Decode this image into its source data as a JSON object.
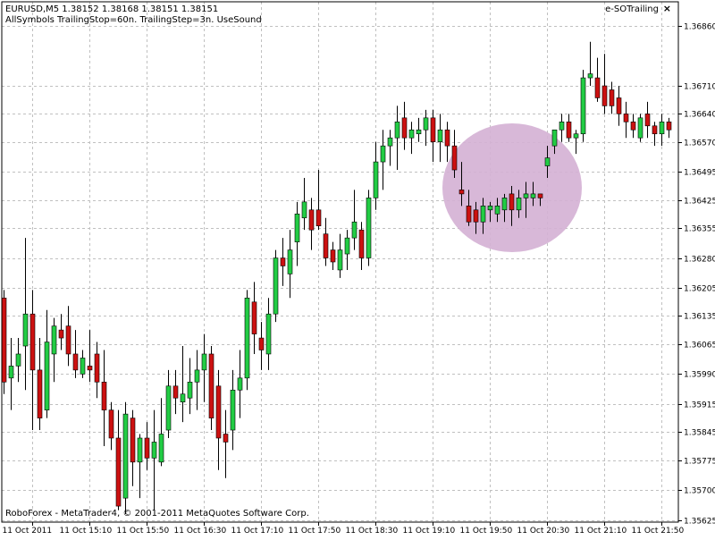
{
  "header": {
    "symbol_line": "EURUSD,M5  1.38152 1.38168 1.38151 1.38151",
    "settings_line": "AllSymbols  TrailingStop=60n.  TrailingStep=3n.  UseSound"
  },
  "expert": {
    "name": "e-SOTrailing",
    "close_glyph": "×"
  },
  "footer": {
    "copyright": "RoboForex - MetaTrader4, © 2001-2011 MetaQuotes Software Corp."
  },
  "colors": {
    "up": "#22cc44",
    "down": "#cc1111",
    "grid": "#c0c0c0",
    "highlight": "#d4b0d4"
  },
  "chart_data": {
    "type": "candlestick",
    "title": "",
    "ylim": [
      1.3562,
      1.3692
    ],
    "y_ticks": [
      "1.36860",
      "1.36710",
      "1.36640",
      "1.36570",
      "1.36495",
      "1.36425",
      "1.36355",
      "1.36280",
      "1.36205",
      "1.36135",
      "1.36065",
      "1.35990",
      "1.35915",
      "1.35845",
      "1.35775",
      "1.35700",
      "1.35625"
    ],
    "x_ticks": [
      "11 Oct 2011",
      "11 Oct 15:10",
      "11 Oct 15:50",
      "11 Oct 16:30",
      "11 Oct 17:10",
      "11 Oct 17:50",
      "11 Oct 18:30",
      "11 Oct 19:10",
      "11 Oct 19:50",
      "11 Oct 20:30",
      "11 Oct 21:10",
      "11 Oct 21:50"
    ],
    "candles": [
      [
        1.3618,
        1.362,
        1.3594,
        1.3597
      ],
      [
        1.3598,
        1.3608,
        1.359,
        1.3601
      ],
      [
        1.3601,
        1.3608,
        1.3597,
        1.3604
      ],
      [
        1.3606,
        1.3633,
        1.3595,
        1.3614
      ],
      [
        1.3614,
        1.362,
        1.3585,
        1.36
      ],
      [
        1.36,
        1.3608,
        1.3585,
        1.3588
      ],
      [
        1.359,
        1.3615,
        1.3588,
        1.3607
      ],
      [
        1.3604,
        1.3613,
        1.3597,
        1.3611
      ],
      [
        1.361,
        1.3614,
        1.3605,
        1.3608
      ],
      [
        1.3611,
        1.3616,
        1.3601,
        1.3604
      ],
      [
        1.3604,
        1.361,
        1.3598,
        1.36
      ],
      [
        1.3599,
        1.3605,
        1.3598,
        1.3603
      ],
      [
        1.3601,
        1.361,
        1.3597,
        1.36
      ],
      [
        1.3604,
        1.3607,
        1.3593,
        1.3597
      ],
      [
        1.3597,
        1.3605,
        1.3581,
        1.359
      ],
      [
        1.359,
        1.3592,
        1.358,
        1.3583
      ],
      [
        1.3583,
        1.359,
        1.3565,
        1.3566
      ],
      [
        1.3568,
        1.3592,
        1.3564,
        1.3589
      ],
      [
        1.3588,
        1.359,
        1.3571,
        1.3577
      ],
      [
        1.3577,
        1.3584,
        1.3568,
        1.3583
      ],
      [
        1.3583,
        1.3587,
        1.3575,
        1.3578
      ],
      [
        1.3578,
        1.359,
        1.3565,
        1.3582
      ],
      [
        1.3577,
        1.3593,
        1.3576,
        1.3584
      ],
      [
        1.3585,
        1.36,
        1.3583,
        1.3596
      ],
      [
        1.3596,
        1.36,
        1.3589,
        1.3593
      ],
      [
        1.3592,
        1.3606,
        1.3587,
        1.3594
      ],
      [
        1.3593,
        1.3603,
        1.3589,
        1.3597
      ],
      [
        1.3597,
        1.3605,
        1.359,
        1.36
      ],
      [
        1.36,
        1.3609,
        1.3592,
        1.3604
      ],
      [
        1.3604,
        1.3606,
        1.3585,
        1.3588
      ],
      [
        1.3596,
        1.36,
        1.3575,
        1.3583
      ],
      [
        1.3584,
        1.359,
        1.3573,
        1.3582
      ],
      [
        1.3585,
        1.36,
        1.358,
        1.3595
      ],
      [
        1.3595,
        1.3605,
        1.3588,
        1.3598
      ],
      [
        1.3598,
        1.362,
        1.3595,
        1.3618
      ],
      [
        1.3617,
        1.3622,
        1.3604,
        1.3609
      ],
      [
        1.3608,
        1.3612,
        1.36,
        1.3605
      ],
      [
        1.3604,
        1.3618,
        1.36,
        1.3614
      ],
      [
        1.3614,
        1.363,
        1.3612,
        1.3628
      ],
      [
        1.3628,
        1.3633,
        1.3621,
        1.3626
      ],
      [
        1.3624,
        1.3635,
        1.3618,
        1.363
      ],
      [
        1.3632,
        1.3642,
        1.3626,
        1.3639
      ],
      [
        1.3638,
        1.3648,
        1.3635,
        1.3642
      ],
      [
        1.364,
        1.3643,
        1.363,
        1.3635
      ],
      [
        1.364,
        1.365,
        1.3635,
        1.3636
      ],
      [
        1.3634,
        1.3638,
        1.3626,
        1.3628
      ],
      [
        1.363,
        1.3632,
        1.3625,
        1.3627
      ],
      [
        1.3625,
        1.3634,
        1.3623,
        1.363
      ],
      [
        1.3629,
        1.3635,
        1.3625,
        1.3633
      ],
      [
        1.3633,
        1.3645,
        1.363,
        1.3637
      ],
      [
        1.3635,
        1.3637,
        1.3625,
        1.3628
      ],
      [
        1.3628,
        1.3645,
        1.3626,
        1.3643
      ],
      [
        1.3643,
        1.3657,
        1.364,
        1.3652
      ],
      [
        1.3652,
        1.366,
        1.3645,
        1.3656
      ],
      [
        1.3656,
        1.366,
        1.3651,
        1.3658
      ],
      [
        1.3658,
        1.3666,
        1.365,
        1.3662
      ],
      [
        1.3663,
        1.3667,
        1.3655,
        1.3658
      ],
      [
        1.3658,
        1.3662,
        1.3654,
        1.366
      ],
      [
        1.3659,
        1.3663,
        1.3657,
        1.366
      ],
      [
        1.366,
        1.3665,
        1.3656,
        1.3663
      ],
      [
        1.3663,
        1.3665,
        1.3652,
        1.3657
      ],
      [
        1.3657,
        1.3664,
        1.3652,
        1.366
      ],
      [
        1.366,
        1.3662,
        1.3652,
        1.3656
      ],
      [
        1.3656,
        1.366,
        1.3648,
        1.365
      ],
      [
        1.3645,
        1.3652,
        1.3641,
        1.3644
      ],
      [
        1.3641,
        1.3645,
        1.3636,
        1.3637
      ],
      [
        1.364,
        1.3642,
        1.3634,
        1.3637
      ],
      [
        1.3637,
        1.3643,
        1.3634,
        1.3641
      ],
      [
        1.364,
        1.3642,
        1.3637,
        1.3641
      ],
      [
        1.3639,
        1.3643,
        1.3637,
        1.3641
      ],
      [
        1.364,
        1.3644,
        1.3637,
        1.3643
      ],
      [
        1.3644,
        1.3646,
        1.3636,
        1.364
      ],
      [
        1.364,
        1.3645,
        1.3638,
        1.3643
      ],
      [
        1.3643,
        1.3647,
        1.3638,
        1.3644
      ],
      [
        1.3643,
        1.3647,
        1.3641,
        1.3644
      ],
      [
        1.3644,
        1.3644,
        1.3641,
        1.3643
      ],
      [
        1.3651,
        1.3656,
        1.3648,
        1.3653
      ],
      [
        1.3656,
        1.366,
        1.3654,
        1.366
      ],
      [
        1.366,
        1.3664,
        1.3657,
        1.3662
      ],
      [
        1.3662,
        1.3664,
        1.3657,
        1.3658
      ],
      [
        1.3658,
        1.366,
        1.3654,
        1.3659
      ],
      [
        1.3659,
        1.3675,
        1.3657,
        1.3673
      ],
      [
        1.3673,
        1.3682,
        1.3671,
        1.3674
      ],
      [
        1.3673,
        1.3678,
        1.3667,
        1.3668
      ],
      [
        1.3671,
        1.3679,
        1.3664,
        1.3666
      ],
      [
        1.367,
        1.3672,
        1.3664,
        1.3666
      ],
      [
        1.3668,
        1.3671,
        1.3661,
        1.3664
      ],
      [
        1.3664,
        1.3667,
        1.3658,
        1.3662
      ],
      [
        1.3662,
        1.3664,
        1.3658,
        1.366
      ],
      [
        1.3658,
        1.3664,
        1.3657,
        1.3663
      ],
      [
        1.3664,
        1.3667,
        1.3658,
        1.3661
      ],
      [
        1.3661,
        1.3662,
        1.3656,
        1.3659
      ],
      [
        1.3659,
        1.3664,
        1.3656,
        1.3662
      ],
      [
        1.3662,
        1.3663,
        1.3658,
        1.366
      ],
      [
        1.3661,
        1.3662,
        1.3658,
        1.3658
      ],
      [
        1.3657,
        1.3663,
        1.3653,
        1.3655
      ],
      [
        1.3655,
        1.366,
        1.3653,
        1.3656
      ],
      [
        1.3656,
        1.3661,
        1.3655,
        1.366
      ],
      [
        1.366,
        1.3664,
        1.3658,
        1.3663
      ],
      [
        1.3663,
        1.3669,
        1.3661,
        1.3668
      ],
      [
        1.3668,
        1.367,
        1.3662,
        1.3664
      ],
      [
        1.3664,
        1.3667,
        1.3661,
        1.3662
      ],
      [
        1.3661,
        1.3665,
        1.3659,
        1.3665
      ]
    ]
  }
}
